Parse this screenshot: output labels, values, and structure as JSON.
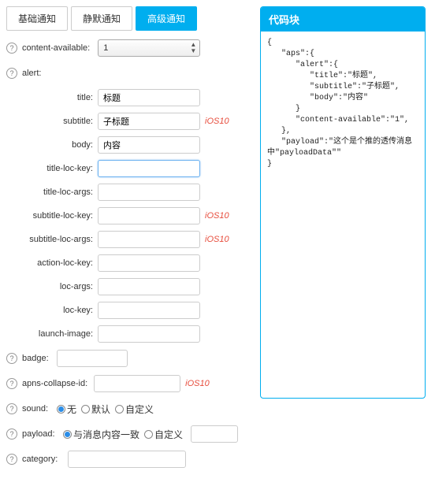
{
  "tabs": [
    {
      "label": "基础通知",
      "active": false
    },
    {
      "label": "静默通知",
      "active": false
    },
    {
      "label": "高级通知",
      "active": true
    }
  ],
  "form": {
    "content_available": {
      "label": "content-available:",
      "value": "1"
    },
    "alert_label": "alert:",
    "alert": {
      "title": {
        "label": "title:",
        "value": "标题"
      },
      "subtitle": {
        "label": "subtitle:",
        "value": "子标题",
        "badge": "iOS10"
      },
      "body": {
        "label": "body:",
        "value": "内容"
      },
      "title_loc_key": {
        "label": "title-loc-key:",
        "value": ""
      },
      "title_loc_args": {
        "label": "title-loc-args:",
        "value": ""
      },
      "subtitle_loc_key": {
        "label": "subtitle-loc-key:",
        "value": "",
        "badge": "iOS10"
      },
      "subtitle_loc_args": {
        "label": "subtitle-loc-args:",
        "value": "",
        "badge": "iOS10"
      },
      "action_loc_key": {
        "label": "action-loc-key:",
        "value": ""
      },
      "loc_args": {
        "label": "loc-args:",
        "value": ""
      },
      "loc_key": {
        "label": "loc-key:",
        "value": ""
      },
      "launch_image": {
        "label": "launch-image:",
        "value": ""
      }
    },
    "badge": {
      "label": "badge:",
      "value": ""
    },
    "apns_collapse_id": {
      "label": "apns-collapse-id:",
      "value": "",
      "badge": "iOS10"
    },
    "sound": {
      "label": "sound:",
      "options": [
        "无",
        "默认",
        "自定义"
      ],
      "selected": 0
    },
    "payload": {
      "label": "payload:",
      "options": [
        "与消息内容一致",
        "自定义"
      ],
      "selected": 0
    },
    "category": {
      "label": "category:",
      "value": ""
    }
  },
  "help_glyph": "?",
  "code_block": {
    "title": "代码块",
    "content": "{\n   \"aps\":{\n      \"alert\":{\n         \"title\":\"标题\",\n         \"subtitle\":\"子标题\",\n         \"body\":\"内容\"\n      }\n      \"content-available\":\"1\",\n   },\n   \"payload\":\"这个是个推的透传消息中\"payloadData\"\"\n}"
  }
}
